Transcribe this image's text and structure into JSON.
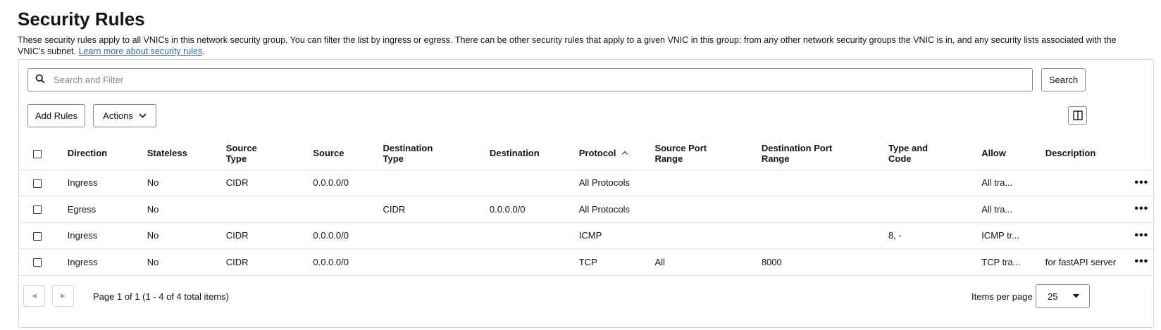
{
  "page": {
    "title": "Security Rules",
    "description": "These security rules apply to all VNICs in this network security group. You can filter the list by ingress or egress. There can be other security rules that apply to a given VNIC in this group: from any other network security groups the VNIC is in, and any security lists associated with the VNIC's subnet. ",
    "learn_more": "Learn more about security rules",
    "period": "."
  },
  "search": {
    "placeholder": "Search and Filter",
    "button": "Search",
    "icon": "search-icon"
  },
  "toolbar": {
    "add_rules": "Add Rules",
    "actions": "Actions",
    "columns_icon": "columns-icon"
  },
  "table": {
    "headers": {
      "direction": "Direction",
      "stateless": "Stateless",
      "source_type_1": "Source",
      "source_type_2": "Type",
      "source": "Source",
      "dest_type_1": "Destination",
      "dest_type_2": "Type",
      "destination": "Destination",
      "protocol": "Protocol",
      "src_port_1": "Source Port",
      "src_port_2": "Range",
      "dst_port_1": "Destination Port",
      "dst_port_2": "Range",
      "type_code_1": "Type and",
      "type_code_2": "Code",
      "allow": "Allow",
      "description": "Description"
    },
    "sort": {
      "column": "Protocol",
      "direction": "ascending"
    },
    "rows": [
      {
        "direction": "Ingress",
        "stateless": "No",
        "source_type": "CIDR",
        "source": "0.0.0.0/0",
        "destination_type": "",
        "destination": "",
        "protocol": "All Protocols",
        "source_port_range": "",
        "destination_port_range": "",
        "type_and_code": "",
        "allow": "All tra...",
        "description": ""
      },
      {
        "direction": "Egress",
        "stateless": "No",
        "source_type": "",
        "source": "",
        "destination_type": "CIDR",
        "destination": "0.0.0.0/0",
        "protocol": "All Protocols",
        "source_port_range": "",
        "destination_port_range": "",
        "type_and_code": "",
        "allow": "All tra...",
        "description": ""
      },
      {
        "direction": "Ingress",
        "stateless": "No",
        "source_type": "CIDR",
        "source": "0.0.0.0/0",
        "destination_type": "",
        "destination": "",
        "protocol": "ICMP",
        "source_port_range": "",
        "destination_port_range": "",
        "type_and_code": "8, -",
        "allow": "ICMP tr...",
        "description": ""
      },
      {
        "direction": "Ingress",
        "stateless": "No",
        "source_type": "CIDR",
        "source": "0.0.0.0/0",
        "destination_type": "",
        "destination": "",
        "protocol": "TCP",
        "source_port_range": "All",
        "destination_port_range": "8000",
        "type_and_code": "",
        "allow": "TCP tra...",
        "description": "for fastAPI server"
      }
    ],
    "row_menu": "•••"
  },
  "pagination": {
    "prev_icon": "◀",
    "next_icon": "▶",
    "info": "Page 1 of 1 (1 - 4 of 4 total items)",
    "items_per_page_label": "Items per page",
    "items_per_page": "25"
  },
  "colors": {
    "link": "#2c6ea3",
    "border": "#d5d3d0",
    "text": "#161513"
  }
}
